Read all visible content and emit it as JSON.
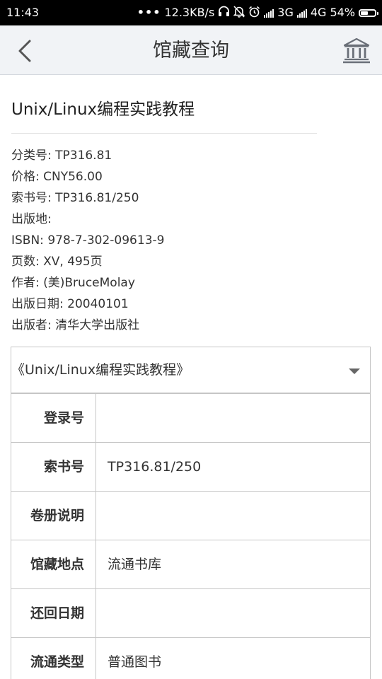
{
  "status_bar": {
    "time": "11:43",
    "dots": "•••",
    "speed": "12.3KB/s",
    "network_3g": "3G",
    "network_4g": "4G",
    "battery_percent": "54%",
    "battery_level": 0.54,
    "icons": [
      "headphones-icon",
      "mute-bell-icon",
      "alarm-icon",
      "signal-icon",
      "battery-icon"
    ]
  },
  "header": {
    "title": "馆藏查询",
    "back_icon": "chevron-left-icon",
    "right_icon": "library-building-icon"
  },
  "book": {
    "title": "Unix/Linux编程实践教程",
    "meta": [
      "分类号: TP316.81",
      "价格: CNY56.00",
      "索书号: TP316.81/250",
      "出版地:",
      "ISBN: 978-7-302-09613-9",
      "页数: XV, 495页",
      "作者: (美)BruceMolay",
      "出版日期: 20040101",
      "出版者: 清华大学出版社"
    ]
  },
  "holdings": {
    "selected_volume": "《Unix/Linux编程实践教程》",
    "dropdown_icon": "caret-down-icon",
    "rows": [
      {
        "label": "登录号",
        "value": ""
      },
      {
        "label": "索书号",
        "value": "TP316.81/250"
      },
      {
        "label": "卷册说明",
        "value": ""
      },
      {
        "label": "馆藏地点",
        "value": "流通书库"
      },
      {
        "label": "还回日期",
        "value": ""
      },
      {
        "label": "流通类型",
        "value": "普通图书"
      }
    ]
  },
  "colors": {
    "status_bar_bg": "#000000",
    "header_bg": "#f1f3f6",
    "text": "#333333",
    "border": "#c6c6c6"
  }
}
